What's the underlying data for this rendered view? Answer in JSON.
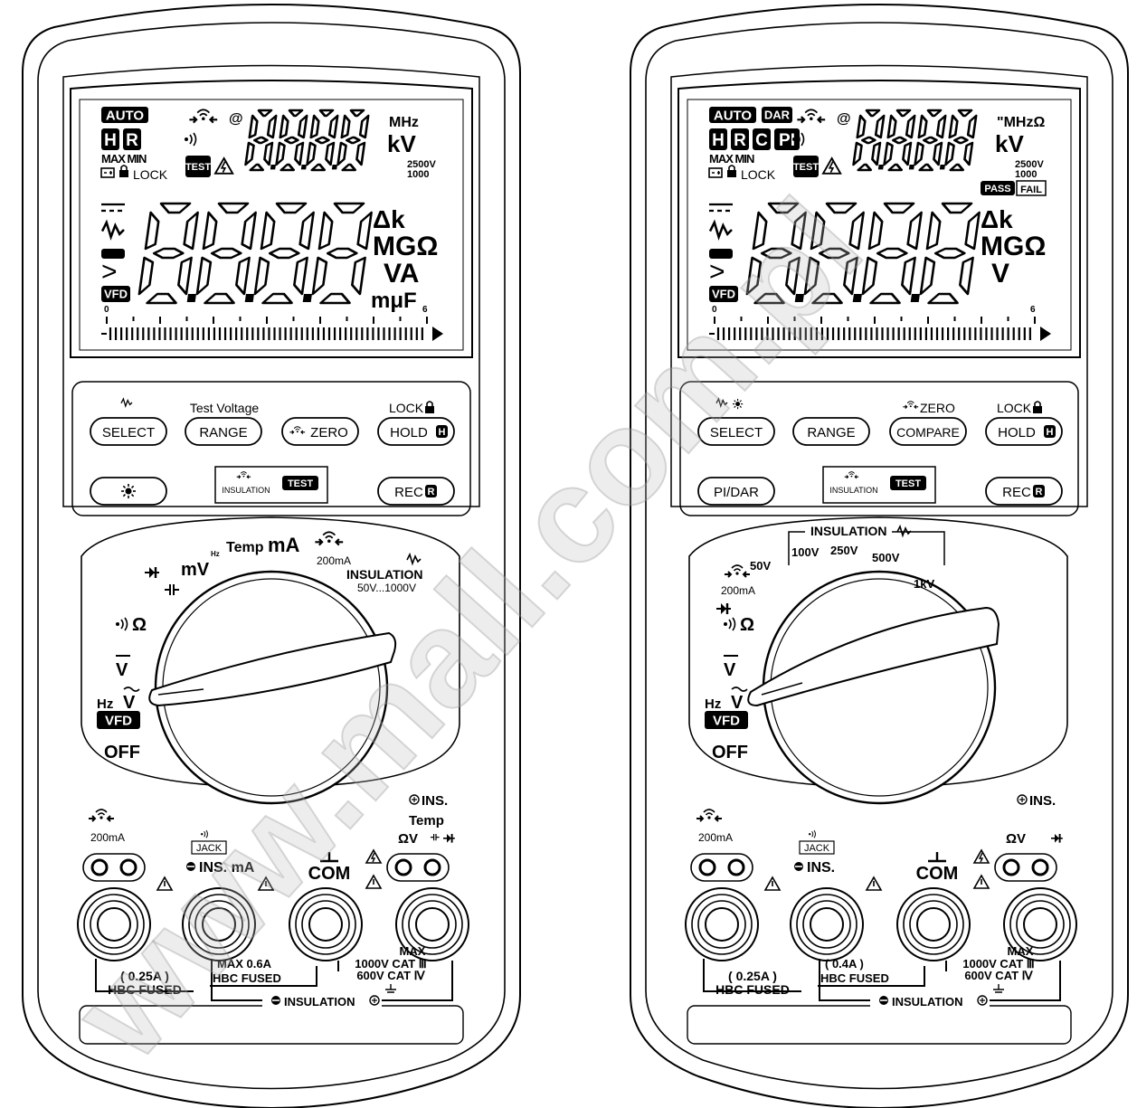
{
  "watermark": "www.mall.com.pl",
  "meters": [
    {
      "id": "left",
      "lcd": {
        "annunciators": {
          "auto": "AUTO",
          "dar": "",
          "letters": [
            "H",
            "R"
          ],
          "maxmin": "MAX MIN",
          "lock": "LOCK",
          "test": "TEST",
          "at": "@",
          "pass": "",
          "fail": ""
        },
        "top_digits": "8888",
        "top_units": {
          "line1": "MHz",
          "line2": "kV",
          "v1": "2500V",
          "v2": "1000"
        },
        "main_digits": "8.8.8.8",
        "main_units": [
          "Δk",
          "MGΩ",
          "VA",
          "mμF"
        ],
        "scale_start": "0",
        "scale_end": "6",
        "side_vfd": "VFD"
      },
      "buttons": {
        "labels_above": [
          "",
          "Test Voltage",
          "ZERO",
          "LOCK"
        ],
        "row1": [
          "SELECT",
          "RANGE",
          "ZERO",
          "HOLD"
        ],
        "row2_left": "",
        "insulation": "INSULATION",
        "test": "TEST",
        "rec": "REC"
      },
      "dial": {
        "positions": [
          "OFF",
          "VFD",
          "Hz",
          "V",
          "V",
          "Ω",
          "mV",
          "Temp mA",
          "200mA",
          "INSULATION",
          "50V...1000V"
        ],
        "insulation_sub": "50V...1000V",
        "temp_ma": "Temp mA",
        "ma200": "200mA",
        "mv": "mV",
        "hz": "Hz"
      },
      "jacks": {
        "left_label": "200mA",
        "jack_label": "JACK",
        "ins_ma": "INS. mA",
        "com": "COM",
        "right_top": "INS.",
        "right_mid": "Temp",
        "right_bot": "ΩV",
        "fuse1_a": "( 0.25A )",
        "fuse1_b": "HBC FUSED",
        "fuse2_a": "MAX 0.6A",
        "fuse2_b": "HBC FUSED",
        "max_a": "MAX",
        "max_b": "1000V CAT Ⅲ",
        "max_c": "600V CAT Ⅳ",
        "insulation": "INSULATION"
      }
    },
    {
      "id": "right",
      "lcd": {
        "annunciators": {
          "auto": "AUTO",
          "dar": "DAR",
          "letters": [
            "H",
            "R",
            "C",
            "PI"
          ],
          "maxmin": "MAX MIN",
          "lock": "LOCK",
          "test": "TEST",
          "at": "@",
          "pass": "PASS",
          "fail": "FAIL"
        },
        "top_digits": "8888",
        "top_units": {
          "line1": "\"MHzΩ",
          "line2": "kV",
          "v1": "2500V",
          "v2": "1000"
        },
        "main_digits": "8.8.8.8",
        "main_units": [
          "Δk",
          "MGΩ",
          "V",
          ""
        ],
        "scale_start": "0",
        "scale_end": "6",
        "side_vfd": "VFD"
      },
      "buttons": {
        "labels_above": [
          "",
          "",
          "ZERO",
          "LOCK"
        ],
        "row1": [
          "SELECT",
          "RANGE",
          "COMPARE",
          "HOLD"
        ],
        "row2_left": "PI/DAR",
        "insulation": "INSULATION",
        "test": "TEST",
        "rec": "REC"
      },
      "dial": {
        "insulation_title": "INSULATION",
        "voltages": [
          "50V",
          "100V",
          "250V",
          "500V",
          "1kV"
        ],
        "ma200": "200mA"
      },
      "jacks": {
        "left_label": "200mA",
        "jack_label": "JACK",
        "ins_ma": "INS.",
        "com": "COM",
        "right_top": "INS.",
        "right_mid": "",
        "right_bot": "ΩV",
        "fuse1_a": "( 0.25A )",
        "fuse1_b": "HBC FUSED",
        "fuse2_a": "( 0.4A )",
        "fuse2_b": "HBC FUSED",
        "max_a": "MAX",
        "max_b": "1000V CAT Ⅲ",
        "max_c": "600V CAT Ⅳ",
        "insulation": "INSULATION"
      }
    }
  ],
  "dial_common": {
    "off": "OFF",
    "vfd": "VFD",
    "hz": "Hz"
  }
}
